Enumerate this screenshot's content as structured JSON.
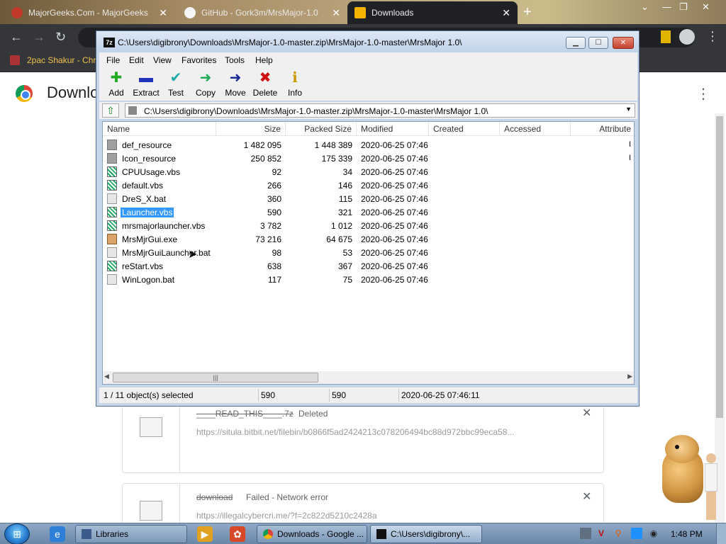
{
  "browser": {
    "tabs": [
      {
        "title": "MajorGeeks.Com - MajorGeeks",
        "icon": "majorgeeks-icon"
      },
      {
        "title": "GitHub - Gork3m/MrsMajor-1.0",
        "icon": "github-icon"
      },
      {
        "title": "Downloads",
        "icon": "downloads-icon",
        "active": true
      }
    ],
    "bookmark": "2pac Shakur - Chro",
    "page_title": "Downlo",
    "downloads": [
      {
        "name": "____READ_THIS____.7z",
        "status": "Deleted",
        "url": "https://situla.bitbit.net/filebin/b0866f5ad2424213c078206494bc88d972bbc99eca58..."
      },
      {
        "name": "download",
        "status": "Failed - Network error",
        "url": "https://illegalcybercri.me/?f=2c822d5210c2428a"
      }
    ]
  },
  "zip": {
    "title": "C:\\Users\\digibrony\\Downloads\\MrsMajor-1.0-master.zip\\MrsMajor-1.0-master\\MrsMajor 1.0\\",
    "app_badge": "7z",
    "menu": [
      "File",
      "Edit",
      "View",
      "Favorites",
      "Tools",
      "Help"
    ],
    "toolbar": [
      {
        "label": "Add",
        "icon": "add-icon",
        "glyph": "✚",
        "color": "#22aa22"
      },
      {
        "label": "Extract",
        "icon": "extract-icon",
        "glyph": "▬",
        "color": "#2233bb"
      },
      {
        "label": "Test",
        "icon": "test-icon",
        "glyph": "✔",
        "color": "#22aaaa"
      },
      {
        "label": "Copy",
        "icon": "copy-icon",
        "glyph": "➜",
        "color": "#22aa55"
      },
      {
        "label": "Move",
        "icon": "move-icon",
        "glyph": "➜",
        "color": "#1a2a99"
      },
      {
        "label": "Delete",
        "icon": "delete-icon",
        "glyph": "✖",
        "color": "#cc1111"
      },
      {
        "label": "Info",
        "icon": "info-icon",
        "glyph": "ℹ",
        "color": "#cc9900"
      }
    ],
    "address": "C:\\Users\\digibrony\\Downloads\\MrsMajor-1.0-master.zip\\MrsMajor-1.0-master\\MrsMajor 1.0\\",
    "columns": [
      "Name",
      "Size",
      "Packed Size",
      "Modified",
      "Created",
      "Accessed",
      "Attribute"
    ],
    "files": [
      {
        "name": "def_resource",
        "type": "folder",
        "size": "1 482 095",
        "packed": "1 448 389",
        "modified": "2020-06-25 07:46",
        "attr_mark": "I"
      },
      {
        "name": "Icon_resource",
        "type": "folder",
        "size": "250 852",
        "packed": "175 339",
        "modified": "2020-06-25 07:46",
        "attr_mark": "I"
      },
      {
        "name": "CPUUsage.vbs",
        "type": "vbs",
        "size": "92",
        "packed": "34",
        "modified": "2020-06-25 07:46"
      },
      {
        "name": "default.vbs",
        "type": "vbs",
        "size": "266",
        "packed": "146",
        "modified": "2020-06-25 07:46"
      },
      {
        "name": "DreS_X.bat",
        "type": "bat",
        "size": "360",
        "packed": "115",
        "modified": "2020-06-25 07:46"
      },
      {
        "name": "Launcher.vbs",
        "type": "vbs",
        "size": "590",
        "packed": "321",
        "modified": "2020-06-25 07:46",
        "selected": true
      },
      {
        "name": "mrsmajorlauncher.vbs",
        "type": "vbs",
        "size": "3 782",
        "packed": "1 012",
        "modified": "2020-06-25 07:46"
      },
      {
        "name": "MrsMjrGui.exe",
        "type": "exe",
        "size": "73 216",
        "packed": "64 675",
        "modified": "2020-06-25 07:46"
      },
      {
        "name": "MrsMjrGuiLauncher.bat",
        "type": "bat",
        "size": "98",
        "packed": "53",
        "modified": "2020-06-25 07:46"
      },
      {
        "name": "reStart.vbs",
        "type": "vbs",
        "size": "638",
        "packed": "367",
        "modified": "2020-06-25 07:46"
      },
      {
        "name": "WinLogon.bat",
        "type": "bat",
        "size": "117",
        "packed": "75",
        "modified": "2020-06-25 07:46"
      }
    ],
    "status": {
      "selection": "1 / 11 object(s) selected",
      "size": "590",
      "packed": "590",
      "modified": "2020-06-25 07:46:11"
    }
  },
  "taskbar": {
    "buttons": [
      {
        "label": "Libraries",
        "icon": "libraries-icon"
      },
      {
        "label": "Downloads - Google ...",
        "icon": "chrome-icon"
      },
      {
        "label": "C:\\Users\\digibrony\\...",
        "icon": "7zip-icon",
        "active": true
      }
    ],
    "clock": "1:48 PM"
  }
}
